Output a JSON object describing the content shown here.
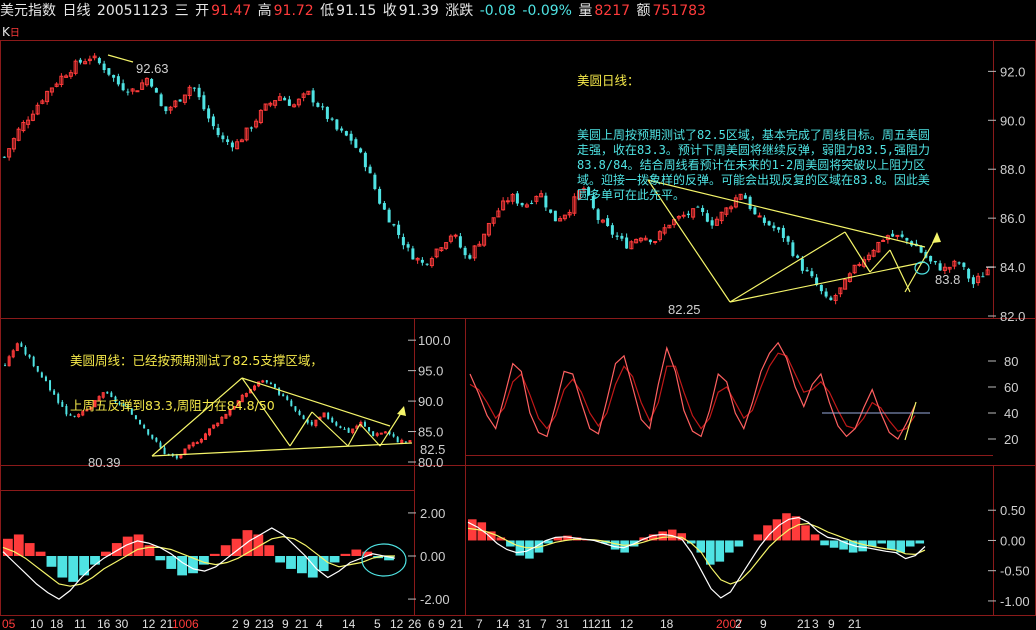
{
  "header": {
    "name": "美元指数",
    "period": "日线",
    "date": "20051123",
    "weekday": "三",
    "open_label": "开",
    "open": "91.47",
    "high_label": "高",
    "high": "91.72",
    "low_label": "低",
    "low": "91.15",
    "close_label": "收",
    "close": "91.39",
    "change_label": "涨跌",
    "change": "-0.08",
    "change_pct": "-0.09%",
    "volume_label": "量",
    "volume": "8217",
    "amount_label": "额",
    "amount": "751783"
  },
  "kbar": {
    "k": "K",
    "sub": "日"
  },
  "daily_note": {
    "title": "美圆日线：",
    "body": "美圆上周按预期测试了82.5区域，基本完成了周线目标。周五美圆走强，收在83.3。预计下周美圆将继续反弹，弱阻力83.5,强阻力83.8/84。结合周线看预计在未来的1-2周美圆将突破以上阻力区域。迎接一拨象样的反弹。可能会出现反复的区域在83.8。因此美圆多单可在此先平。"
  },
  "weekly_note": {
    "line1": "美圆周线：已经按预期测试了82.5支撑区域，",
    "line2": "上周五反弹到83.3,周阻力在84.8/50"
  },
  "colors": {
    "up": "#ff3b3b",
    "down": "#4fe3e3",
    "trend": "#f5f56a",
    "ma": "#ffffff",
    "grid": "#8a1a1a"
  },
  "chart_data": [
    {
      "type": "candlestick",
      "name": "daily",
      "ylim": [
        82,
        93.2
      ],
      "y_ticks": [
        "92.0",
        "90.0",
        "88.0",
        "86.0",
        "84.0",
        "82.0"
      ],
      "annotations": [
        "92.63",
        "82.25",
        "83.8"
      ],
      "x_labels": [
        "7",
        "14",
        "31",
        "7",
        "31",
        "11",
        "21",
        "1",
        "12",
        "18",
        "2007",
        "2",
        "9",
        "21",
        "3",
        "9",
        "21"
      ],
      "close_path": [
        88.5,
        89.6,
        90.4,
        91.2,
        91.8,
        92.3,
        92.6,
        92.1,
        91.4,
        91.2,
        91.8,
        90.3,
        90.8,
        91.5,
        90.2,
        89.2,
        89.0,
        89.7,
        90.5,
        91.0,
        90.6,
        91.1,
        90.4,
        89.6,
        89.2,
        88.2,
        86.6,
        85.6,
        84.6,
        84.1,
        84.8,
        85.4,
        84.3,
        85.2,
        86.2,
        86.9,
        86.5,
        87.1,
        85.9,
        86.3,
        87.3,
        86.0,
        85.4,
        84.9,
        85.3,
        85.1,
        85.8,
        86.1,
        86.3,
        85.8,
        86.4,
        87.1,
        86.0,
        85.7,
        85.2,
        84.1,
        83.4,
        82.5,
        83.2,
        84.1,
        84.7,
        85.3,
        85.2,
        84.9,
        84.2,
        83.9,
        84.2,
        83.3,
        83.9
      ]
    },
    {
      "type": "candlestick",
      "name": "weekly",
      "ylim": [
        80,
        102
      ],
      "y_ticks": [
        "100.0",
        "95.0",
        "90.0",
        "85.0",
        "80.0"
      ],
      "annotations": [
        "80.39",
        "82.5"
      ],
      "close_path": [
        96,
        99.5,
        97,
        94,
        91,
        88,
        87.5,
        89,
        91.5,
        90,
        88.5,
        86.5,
        84,
        81.5,
        80.6,
        82.5,
        84,
        86,
        88,
        90,
        92,
        93.5,
        92,
        90,
        87.5,
        86,
        87.8,
        86.2,
        85,
        86.4,
        84.5,
        85,
        83.5,
        83.3
      ]
    },
    {
      "type": "oscillator",
      "name": "kdj",
      "ylim": [
        10,
        100
      ],
      "y_ticks": [
        "80",
        "60",
        "40",
        "20"
      ],
      "k": [
        70,
        55,
        38,
        28,
        52,
        78,
        72,
        40,
        25,
        22,
        46,
        72,
        70,
        48,
        28,
        24,
        50,
        78,
        84,
        60,
        35,
        28,
        62,
        90,
        72,
        42,
        26,
        22,
        42,
        70,
        64,
        40,
        28,
        48,
        72,
        86,
        94,
        82,
        60,
        45,
        62,
        70,
        48,
        30,
        22,
        28,
        44,
        58,
        40,
        25,
        20,
        32,
        46
      ],
      "d": [
        62,
        58,
        48,
        36,
        44,
        64,
        70,
        54,
        36,
        28,
        38,
        58,
        66,
        56,
        40,
        30,
        40,
        62,
        76,
        68,
        48,
        34,
        48,
        76,
        76,
        56,
        38,
        28,
        36,
        56,
        60,
        48,
        36,
        42,
        60,
        76,
        86,
        84,
        70,
        56,
        58,
        64,
        56,
        42,
        30,
        28,
        36,
        48,
        44,
        34,
        26,
        28,
        38
      ],
      "level_line": 40
    },
    {
      "type": "macd",
      "name": "daily_macd",
      "ylim": [
        -1.15,
        1.0
      ],
      "y_ticks": [
        "0.50",
        "0.00",
        "-0.50",
        "-1.00"
      ],
      "histogram": [
        0.35,
        0.3,
        0.15,
        0.05,
        -0.1,
        -0.25,
        -0.3,
        -0.2,
        -0.05,
        0.05,
        0.08,
        0.05,
        0.02,
        0.0,
        -0.05,
        -0.15,
        -0.2,
        -0.1,
        0.05,
        0.1,
        0.15,
        0.18,
        0.12,
        -0.05,
        -0.2,
        -0.4,
        -0.35,
        -0.2,
        -0.1,
        0.0,
        0.1,
        0.25,
        0.35,
        0.45,
        0.4,
        0.25,
        0.1,
        -0.08,
        -0.12,
        -0.15,
        -0.2,
        -0.18,
        -0.1,
        -0.05,
        -0.15,
        -0.2,
        -0.1,
        -0.05
      ],
      "dif": [
        0.3,
        0.22,
        0.1,
        -0.05,
        -0.15,
        -0.2,
        -0.18,
        -0.1,
        0.0,
        0.05,
        0.06,
        0.04,
        0.02,
        0.0,
        -0.05,
        -0.1,
        -0.12,
        -0.06,
        0.02,
        0.08,
        0.1,
        0.08,
        0.02,
        -0.2,
        -0.5,
        -0.8,
        -0.95,
        -0.85,
        -0.6,
        -0.35,
        -0.1,
        0.1,
        0.25,
        0.35,
        0.38,
        0.3,
        0.15,
        0.05,
        0.02,
        -0.05,
        -0.1,
        -0.12,
        -0.15,
        -0.18,
        -0.2,
        -0.3,
        -0.25,
        -0.1
      ],
      "dea": [
        0.2,
        0.18,
        0.14,
        0.08,
        0.0,
        -0.08,
        -0.12,
        -0.12,
        -0.08,
        -0.03,
        0.0,
        0.02,
        0.02,
        0.01,
        -0.01,
        -0.05,
        -0.08,
        -0.07,
        -0.03,
        0.02,
        0.05,
        0.06,
        0.05,
        -0.05,
        -0.2,
        -0.45,
        -0.65,
        -0.72,
        -0.66,
        -0.5,
        -0.3,
        -0.1,
        0.05,
        0.18,
        0.26,
        0.28,
        0.22,
        0.14,
        0.08,
        0.02,
        -0.04,
        -0.08,
        -0.11,
        -0.14,
        -0.16,
        -0.22,
        -0.23,
        -0.16
      ]
    },
    {
      "type": "macd",
      "name": "weekly_macd",
      "ylim": [
        -2.6,
        2.6
      ],
      "y_ticks": [
        "2.00",
        "0.00",
        "-2.00"
      ],
      "x_labels": [
        "05",
        "10",
        "18",
        "11",
        "16",
        "30",
        "12",
        "21",
        "1006",
        "2",
        "9",
        "21",
        "3",
        "9",
        "21",
        "4",
        "14",
        "5",
        "12",
        "26",
        "6",
        "9",
        "21"
      ],
      "histogram": [
        0.8,
        1.0,
        0.6,
        0.2,
        -0.5,
        -1.0,
        -1.2,
        -0.9,
        -0.4,
        0.2,
        0.6,
        0.9,
        1.0,
        0.5,
        -0.2,
        -0.6,
        -0.9,
        -0.8,
        -0.4,
        0.1,
        0.5,
        0.8,
        1.2,
        1.0,
        0.5,
        -0.3,
        -0.6,
        -0.8,
        -1.0,
        -0.7,
        -0.3,
        0.1,
        0.3,
        0.2,
        -0.1,
        -0.2
      ],
      "dif": [
        0.2,
        -0.3,
        -0.8,
        -1.3,
        -1.7,
        -2.0,
        -1.6,
        -1.0,
        -0.5,
        -0.1,
        0.2,
        0.5,
        0.7,
        0.6,
        0.4,
        0.1,
        -0.3,
        -0.6,
        -0.7,
        -0.5,
        -0.1,
        0.3,
        0.7,
        1.0,
        1.3,
        1.0,
        0.5,
        0.0,
        -0.6,
        -1.0,
        -0.7,
        -0.3,
        -0.1,
        0.1,
        0.0,
        -0.1
      ],
      "dea": [
        0.4,
        0.2,
        -0.1,
        -0.5,
        -0.9,
        -1.3,
        -1.4,
        -1.3,
        -1.0,
        -0.6,
        -0.3,
        0.0,
        0.3,
        0.4,
        0.4,
        0.3,
        0.1,
        -0.1,
        -0.3,
        -0.4,
        -0.3,
        -0.1,
        0.2,
        0.5,
        0.8,
        0.9,
        0.8,
        0.5,
        0.1,
        -0.3,
        -0.5,
        -0.4,
        -0.3,
        -0.1,
        0.0,
        0.0
      ]
    }
  ]
}
